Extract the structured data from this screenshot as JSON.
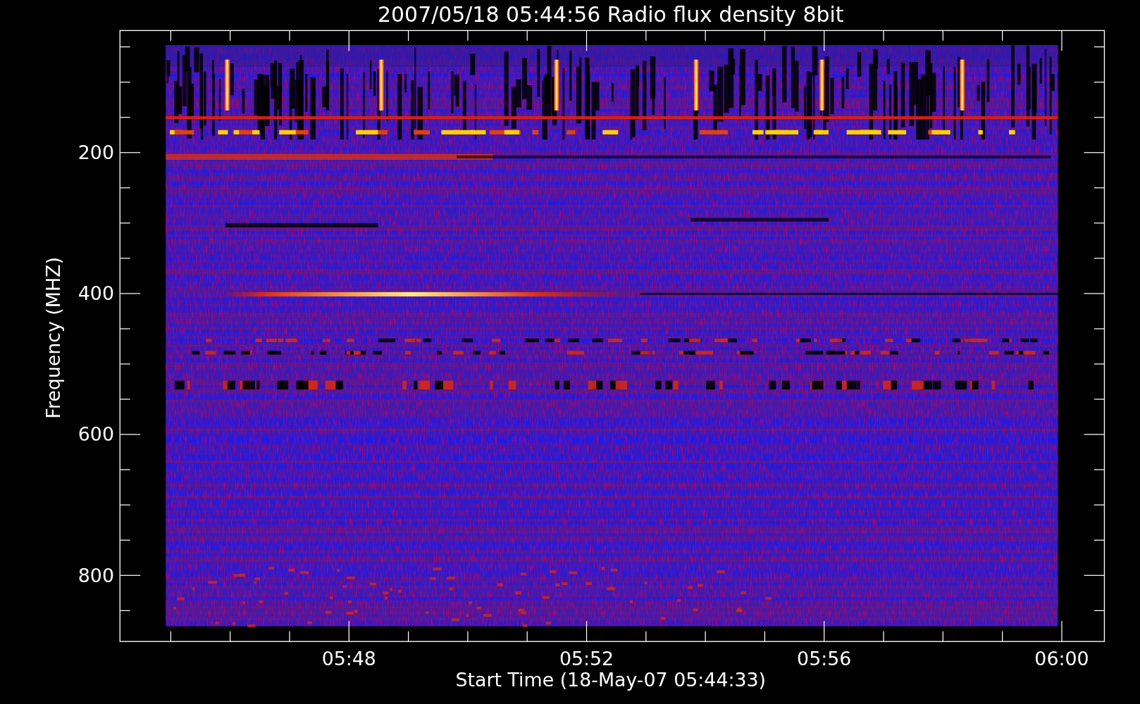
{
  "title": "2007/05/18 05:44:56 Radio flux density 8bit",
  "plot": {
    "ylabel": "Frequency (MHZ)",
    "xlabel": "Start Time (18-May-07 05:44:33)",
    "yticks": [
      {
        "label": "200"
      },
      {
        "label": "400"
      },
      {
        "label": "600"
      },
      {
        "label": "800"
      }
    ],
    "xticks": [
      {
        "label": "05:48"
      },
      {
        "label": "05:52"
      },
      {
        "label": "05:56"
      },
      {
        "label": "06:00"
      }
    ]
  }
}
